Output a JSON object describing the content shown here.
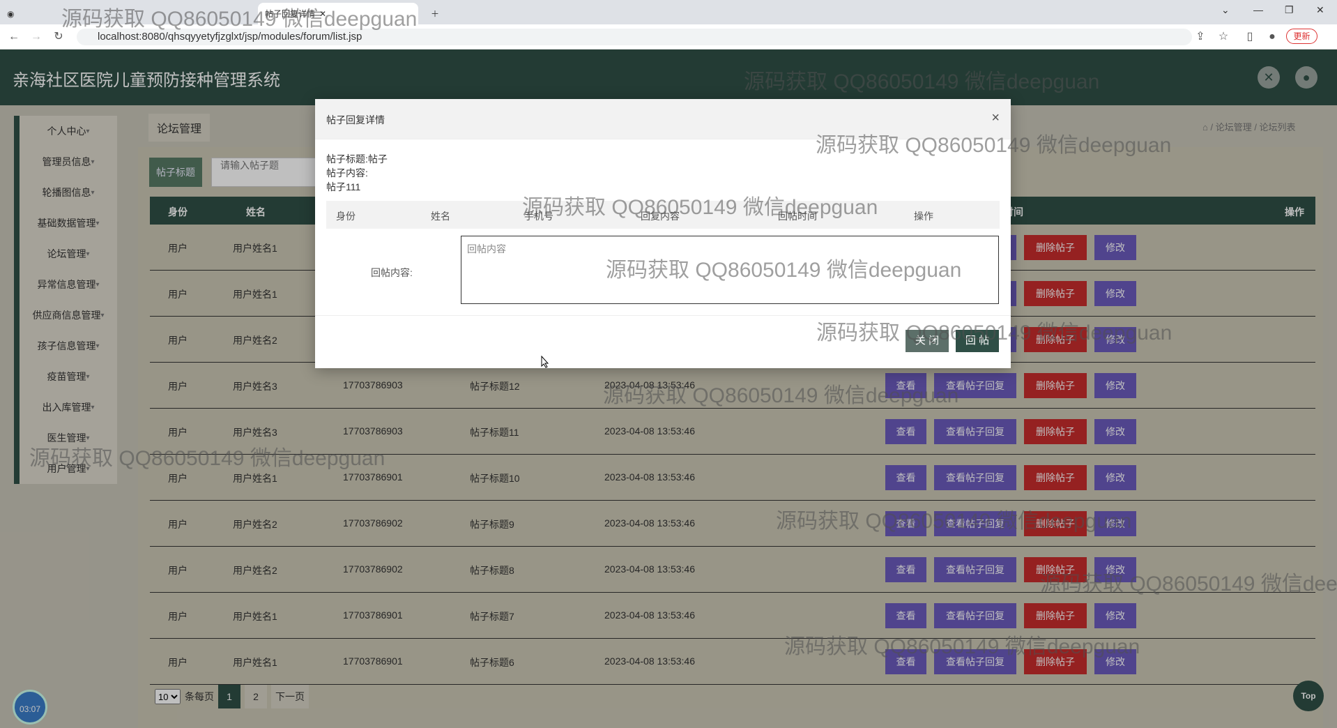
{
  "browser": {
    "tab_label": "帖子回复详情",
    "url": "localhost:8080/qhsqyyetyfjzglxt/jsp/modules/forum/list.jsp",
    "update_label": "更新"
  },
  "header": {
    "title": "亲海社区医院儿童预防接种管理系统"
  },
  "sidebar": {
    "items": [
      {
        "label": "个人中心"
      },
      {
        "label": "管理员信息"
      },
      {
        "label": "轮播图信息"
      },
      {
        "label": "基础数据管理"
      },
      {
        "label": "论坛管理"
      },
      {
        "label": "异常信息管理"
      },
      {
        "label": "供应商信息管理"
      },
      {
        "label": "孩子信息管理"
      },
      {
        "label": "疫苗管理"
      },
      {
        "label": "出入库管理"
      },
      {
        "label": "医生管理"
      },
      {
        "label": "用户管理"
      }
    ]
  },
  "content": {
    "tab_title": "论坛管理",
    "breadcrumb": "/ 论坛管理 / 论坛列表",
    "search_label": "帖子标题",
    "search_placeholder": "请输入帖子题"
  },
  "table": {
    "headers": {
      "identity": "身份",
      "name": "姓名",
      "time": "时间",
      "actions": "操作"
    },
    "rows": [
      {
        "identity": "用户",
        "name": "用户姓名1",
        "phone": "",
        "title": "",
        "time": ""
      },
      {
        "identity": "用户",
        "name": "用户姓名1",
        "phone": "",
        "title": "",
        "time": ""
      },
      {
        "identity": "用户",
        "name": "用户姓名2",
        "phone": "",
        "title": "",
        "time": ""
      },
      {
        "identity": "用户",
        "name": "用户姓名3",
        "phone": "17703786903",
        "title": "帖子标题12",
        "time": "2023-04-08 13:53:46"
      },
      {
        "identity": "用户",
        "name": "用户姓名3",
        "phone": "17703786903",
        "title": "帖子标题11",
        "time": "2023-04-08 13:53:46"
      },
      {
        "identity": "用户",
        "name": "用户姓名1",
        "phone": "17703786901",
        "title": "帖子标题10",
        "time": "2023-04-08 13:53:46"
      },
      {
        "identity": "用户",
        "name": "用户姓名2",
        "phone": "17703786902",
        "title": "帖子标题9",
        "time": "2023-04-08 13:53:46"
      },
      {
        "identity": "用户",
        "name": "用户姓名2",
        "phone": "17703786902",
        "title": "帖子标题8",
        "time": "2023-04-08 13:53:46"
      },
      {
        "identity": "用户",
        "name": "用户姓名1",
        "phone": "17703786901",
        "title": "帖子标题7",
        "time": "2023-04-08 13:53:46"
      },
      {
        "identity": "用户",
        "name": "用户姓名1",
        "phone": "17703786901",
        "title": "帖子标题6",
        "time": "2023-04-08 13:53:46"
      }
    ],
    "btn_view": "查看",
    "btn_view_replies": "查看帖子回复",
    "btn_delete": "删除帖子",
    "btn_edit": "修改"
  },
  "pagination": {
    "page_size": "10",
    "per_page_label": "条每页",
    "pages": [
      "1",
      "2"
    ],
    "next": "下一页"
  },
  "clock": "03:07",
  "top_label": "Top",
  "modal": {
    "title": "帖子回复详情",
    "post_title_line": "帖子标题:帖子",
    "post_content_label": "帖子内容:",
    "post_content": "帖子111",
    "reply_headers": [
      "身份",
      "姓名",
      "手机号",
      "回复内容",
      "回帖时间",
      "操作"
    ],
    "reply_label": "回帖内容:",
    "reply_placeholder": "回帖内容",
    "close_label": "关 闭",
    "reply_button": "回 帖"
  },
  "watermark": "源码获取 QQ86050149 微信deepguan"
}
